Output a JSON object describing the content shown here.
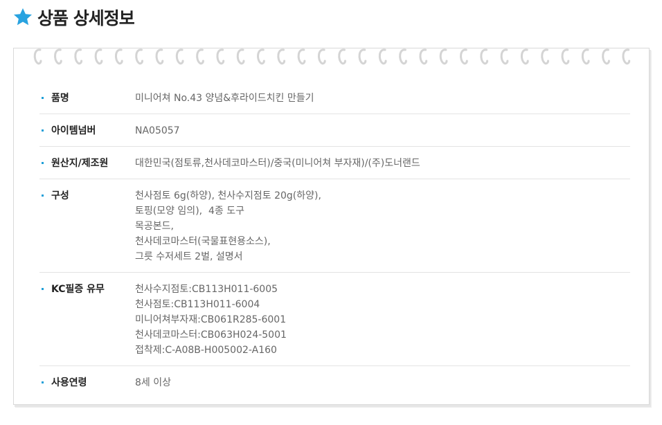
{
  "header": {
    "title": "상품 상세정보",
    "icon": "star-icon",
    "icon_color": "#29a3e0"
  },
  "details": {
    "rows": [
      {
        "label": "품명",
        "lines": [
          "미니어쳐 No.43 양념&후라이드치킨 만들기"
        ]
      },
      {
        "label": "아이템넘버",
        "lines": [
          "NA05057"
        ]
      },
      {
        "label": "원산지/제조원",
        "lines": [
          "대한민국(점토류,천사데코마스터)/중국(미니어쳐 부자재)/(주)도너랜드"
        ]
      },
      {
        "label": "구성",
        "lines": [
          "천사점토 6g(하양), 천사수지점토 20g(하양),",
          "토핑(모양 임의),  4종 도구",
          "목공본드,",
          "천사데코마스터(국물표현용소스),",
          "그릇 수저세트 2벌, 설명서"
        ]
      },
      {
        "label": "KC필증 유무",
        "lines": [
          "천사수지점토:CB113H011-6005",
          "천사점토:CB113H011-6004",
          "미니어쳐부자재:CB061R285-6001",
          "천사데코마스터:CB063H024-5001",
          "접착제:C-A08B-H005002-A160"
        ]
      },
      {
        "label": "사용연령",
        "lines": [
          "8세 이상"
        ]
      }
    ],
    "bullet_color": "#1e9fd8"
  }
}
